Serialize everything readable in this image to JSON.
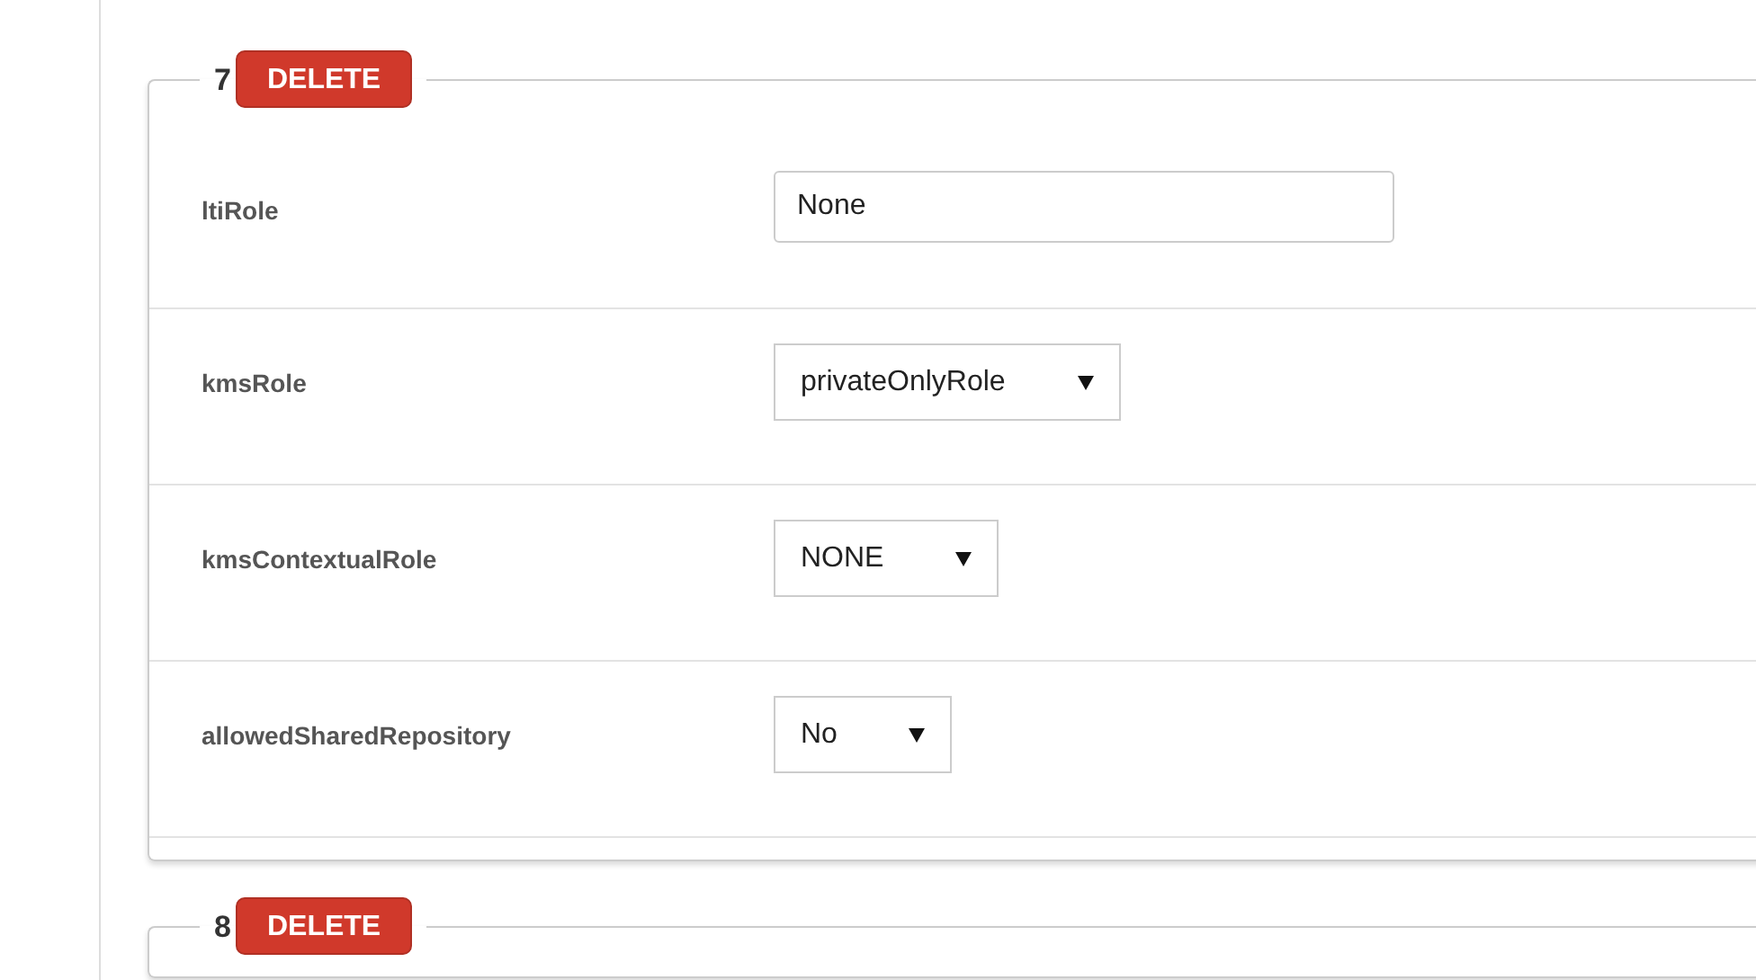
{
  "sections": [
    {
      "number": "7",
      "delete_label": "DELETE",
      "fields": [
        {
          "label": "ltiRole",
          "kind": "text",
          "value": "None"
        },
        {
          "label": "kmsRole",
          "kind": "select",
          "value": "privateOnlyRole"
        },
        {
          "label": "kmsContextualRole",
          "kind": "select",
          "value": "NONE"
        },
        {
          "label": "allowedSharedRepository",
          "kind": "select",
          "value": "No"
        }
      ]
    },
    {
      "number": "8",
      "delete_label": "DELETE"
    }
  ]
}
